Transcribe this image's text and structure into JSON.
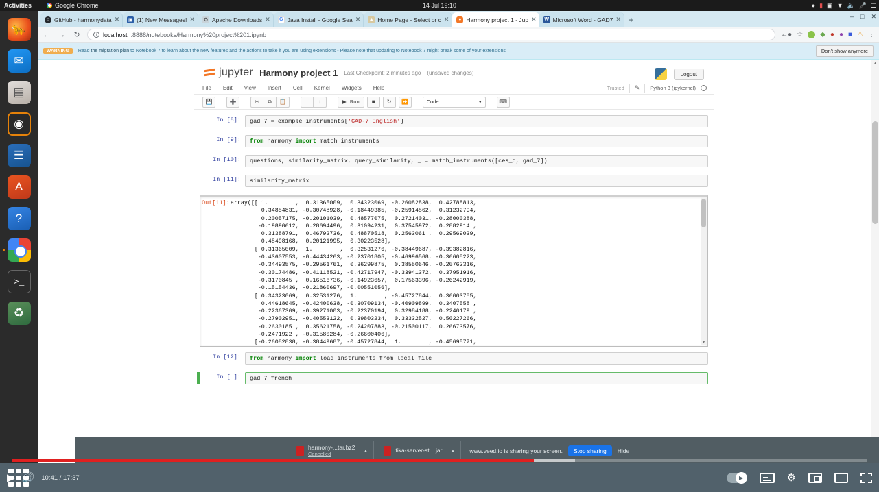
{
  "system_bar": {
    "activities": "Activities",
    "app_name": "Google Chrome",
    "clock": "14 Jul  19:10",
    "tray_icons": [
      "ibus-icon",
      "battery-icon",
      "dropbox-icon",
      "caret-down-icon",
      "volume-icon",
      "mic-icon",
      "network-icon"
    ]
  },
  "dock": {
    "items": [
      {
        "name": "firefox",
        "glyph": "🦊"
      },
      {
        "name": "thunderbird",
        "glyph": "✉"
      },
      {
        "name": "files",
        "glyph": "▤"
      },
      {
        "name": "rhythmbox",
        "glyph": "◉"
      },
      {
        "name": "libreoffice-writer",
        "glyph": "☰"
      },
      {
        "name": "ubuntu-software",
        "glyph": "A"
      },
      {
        "name": "help",
        "glyph": "?"
      },
      {
        "name": "google-chrome",
        "glyph": ""
      },
      {
        "name": "terminal",
        "glyph": ">_"
      },
      {
        "name": "trash",
        "glyph": "♻"
      }
    ]
  },
  "browser": {
    "tabs": [
      {
        "title": "GitHub - harmonydata",
        "favicon": "github",
        "active": false
      },
      {
        "title": "(1) New Messages!",
        "favicon": "msg",
        "active": false
      },
      {
        "title": "Apache Downloads",
        "favicon": "apache",
        "active": false
      },
      {
        "title": "Java Install - Google Sea",
        "favicon": "google",
        "active": false
      },
      {
        "title": "Home Page - Select or c",
        "favicon": "home",
        "active": false
      },
      {
        "title": "Harmony project 1 - Jup",
        "favicon": "jupyter",
        "active": true
      },
      {
        "title": "Microsoft Word - GAD7",
        "favicon": "word",
        "active": false
      }
    ],
    "new_tab_label": "+",
    "window_controls": [
      "minimize",
      "maximize",
      "close"
    ],
    "nav": {
      "back": "←",
      "forward": "→",
      "reload": "↻"
    },
    "omnibox": {
      "host": "localhost",
      "path": ":8888/notebooks/Harmony%20project%201.ipynb",
      "info_icon": "i"
    },
    "right_icons": [
      "share-icon",
      "bookmark-star-icon",
      "extension-icon",
      "profile-icon",
      "sidebar-icon",
      "update-icon",
      "menu-icon"
    ]
  },
  "banner": {
    "tag": "WARNING",
    "link_text": "the migration plan",
    "text_before": "Read ",
    "text_after": " to Notebook 7 to learn about the new features and the actions to take if you are using extensions - Please note that updating to Notebook 7 might break some of your extensions",
    "dismiss_label": "Don't show anymore"
  },
  "jupyter": {
    "logo_text": "jupyter",
    "notebook_title": "Harmony project 1",
    "checkpoint": "Last Checkpoint: 2 minutes ago",
    "unsaved": "(unsaved changes)",
    "logout_label": "Logout",
    "menus": [
      "File",
      "Edit",
      "View",
      "Insert",
      "Cell",
      "Kernel",
      "Widgets",
      "Help"
    ],
    "trusted_label": "Trusted",
    "kernel_name": "Python 3 (ipykernel)",
    "toolbar": {
      "save": "💾",
      "add": "➕",
      "cut": "✂",
      "copy": "⧉",
      "paste": "📋",
      "move_up": "↑",
      "move_down": "↓",
      "run_label": "Run",
      "interrupt": "■",
      "restart": "↻",
      "restart_run_all": "⏩",
      "cell_type": "Code",
      "command_palette": "⌨"
    },
    "cells": [
      {
        "prompt": "In [8]:",
        "code": "gad_7 = example_instruments['GAD-7 English']"
      },
      {
        "prompt": "In [9]:",
        "code": "from harmony import match_instruments"
      },
      {
        "prompt": "In [10]:",
        "code": "questions, similarity_matrix, query_similarity, _ = match_instruments([ces_d, gad_7])"
      },
      {
        "prompt": "In [11]:",
        "code": "similarity_matrix"
      }
    ],
    "output": {
      "prompt": "Out[11]:",
      "text": "array([[ 1.        ,  0.31365009,  0.34323069, -0.26082838,  0.42788813,\n         0.34854831, -0.30748928, -0.18449385, -0.25914562,  0.31232794,\n         0.20057175, -0.20101039,  0.48577075,  0.27214031, -0.28000388,\n        -0.19890612,  0.28694496,  0.31094231,  0.37545972,  0.2882914 ,\n         0.31388791,  0.46792736,  0.48870518,  0.2563061 ,  0.29569039,\n         0.48498168,  0.20121995,  0.30223528],\n       [ 0.31365009,  1.        ,  0.32531276, -0.38449687, -0.39382816,\n        -0.43607553, -0.44434263, -0.23701805, -0.46996568, -0.36608223,\n        -0.34493575, -0.29561761,  0.36299875,  0.38550646, -0.20762316,\n        -0.30174486, -0.41118521, -0.42717947, -0.33941372,  0.37951916,\n        -0.3170845 ,  0.16516736, -0.14923657,  0.17563396, -0.26242919,\n        -0.15154436, -0.21860697, -0.00551056],\n       [ 0.34323069,  0.32531276,  1.        , -0.45727844,  0.36003785,\n         0.44618645, -0.42400638, -0.30709134, -0.40909899,  0.3407558 ,\n        -0.22367309, -0.39271003, -0.22370194,  0.32984188, -0.2240179 ,\n        -0.27902951, -0.40553122,  0.39803234,  0.33332527,  0.50227266,\n        -0.2630185 ,  0.35621758, -0.24207883, -0.21500117,  0.26673576,\n        -0.2471922 , -0.31580284, -0.26600406],\n       [-0.26082838, -0.38449687, -0.45727844,  1.        , -0.45695771,"
    },
    "cells_after": [
      {
        "prompt": "In [12]:",
        "code": "from harmony import load_instruments_from_local_file"
      },
      {
        "prompt": "In [ ]:",
        "code": "gad_7_french",
        "selected": true
      }
    ]
  },
  "player": {
    "play_icon": "▶",
    "volume_icon": "🔊",
    "timecode": "10:41 / 17:37",
    "autoplay_label": "autoplay-toggle",
    "subtitles_label": "subtitles-icon",
    "settings_label": "settings-gear-icon",
    "miniplayer_label": "miniplayer-icon",
    "theater_label": "theater-mode-icon",
    "fullscreen_label": "fullscreen-icon",
    "progress_played_pct": 61
  },
  "downloads": [
    {
      "filename": "harmony-...tar.bz2",
      "status": "Cancelled"
    },
    {
      "filename": "tika-server-st....jar",
      "status": ""
    }
  ],
  "share_notification": {
    "text": "www.veed.io is sharing your screen.",
    "stop_label": "Stop sharing",
    "hide_label": "Hide"
  }
}
